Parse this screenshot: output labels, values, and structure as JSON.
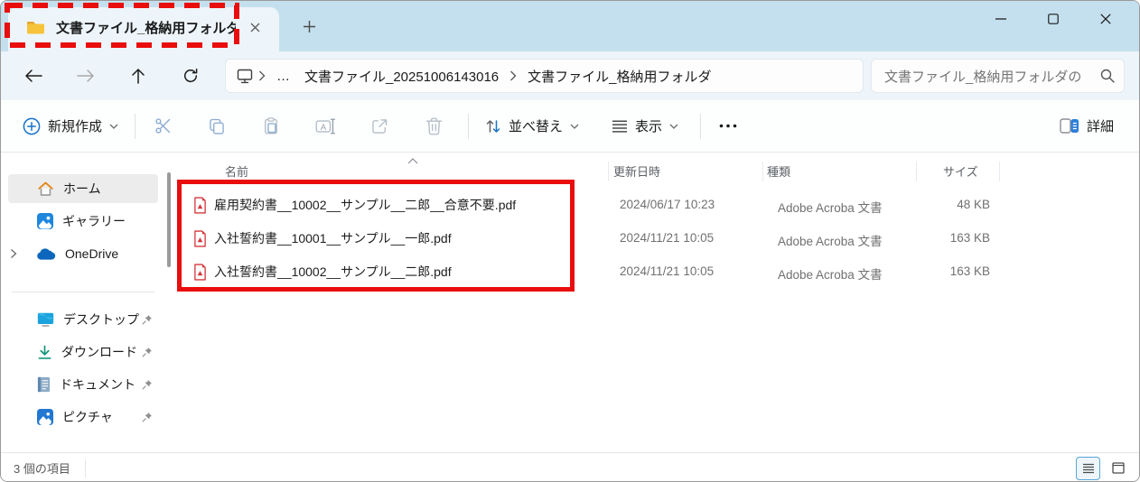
{
  "titlebar": {
    "tab_title": "文書ファイル_格納用フォルダ"
  },
  "navigation": {
    "breadcrumb_overflow": "…",
    "path_segment_1": "文書ファイル_20251006143016",
    "path_segment_2": "文書ファイル_格納用フォルダ",
    "search_placeholder": "文書ファイル_格納用フォルダの"
  },
  "toolbar": {
    "new_label": "新規作成",
    "sort_label": "並べ替え",
    "view_label": "表示",
    "details_label": "詳細"
  },
  "sidebar": {
    "items": [
      {
        "label": "ホーム"
      },
      {
        "label": "ギャラリー"
      },
      {
        "label": "OneDrive"
      },
      {
        "label": "デスクトップ"
      },
      {
        "label": "ダウンロード"
      },
      {
        "label": "ドキュメント"
      },
      {
        "label": "ピクチャ"
      }
    ]
  },
  "files": {
    "columns": {
      "name": "名前",
      "modified": "更新日時",
      "type": "種類",
      "size": "サイズ"
    },
    "rows": [
      {
        "name": "雇用契約書__10002__サンプル__二郎__合意不要.pdf",
        "modified": "2024/06/17 10:23",
        "type": "Adobe Acroba 文書",
        "size": "48 KB"
      },
      {
        "name": "入社誓約書__10001__サンプル__一郎.pdf",
        "modified": "2024/11/21 10:05",
        "type": "Adobe Acroba 文書",
        "size": "163 KB"
      },
      {
        "name": "入社誓約書__10002__サンプル__二郎.pdf",
        "modified": "2024/11/21 10:05",
        "type": "Adobe Acroba 文書",
        "size": "163 KB"
      }
    ]
  },
  "statusbar": {
    "count": "3 個の項目"
  },
  "colors": {
    "annotation_red": "#e90d0d",
    "accent_blue": "#1673c9",
    "titlebar_bg": "#c4e0ee",
    "pdf_icon_red": "#d6363b"
  }
}
